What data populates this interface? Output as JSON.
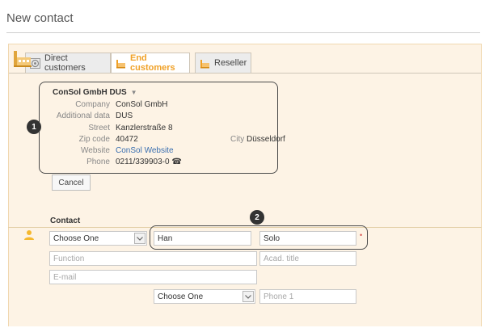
{
  "page": {
    "title": "New contact"
  },
  "tabs": [
    {
      "label": "Direct customers",
      "icon": "target-icon",
      "active": false
    },
    {
      "label": "End customers",
      "icon": "building-icon",
      "active": true
    },
    {
      "label": "Reseller",
      "icon": "building-icon",
      "active": false
    }
  ],
  "company": {
    "name": "ConSol GmbH DUS",
    "rows": {
      "company": {
        "label": "Company",
        "value": "ConSol GmbH"
      },
      "additional": {
        "label": "Additional data",
        "value": "DUS"
      },
      "street": {
        "label": "Street",
        "value": "Kanzlerstraße 8"
      },
      "zip": {
        "label": "Zip code",
        "value": "40472"
      },
      "city": {
        "label": "City",
        "value": "Düsseldorf"
      },
      "website": {
        "label": "Website",
        "value": "ConSol Website"
      },
      "phone": {
        "label": "Phone",
        "value": "0211/339903-0",
        "icon": "telephone-icon"
      }
    },
    "cancel_label": "Cancel"
  },
  "callouts": {
    "one": "1",
    "two": "2"
  },
  "contact": {
    "section_label": "Contact",
    "salutation_select": "Choose One",
    "first_name": "Han",
    "last_name": "Solo",
    "function_placeholder": "Function",
    "acad_title_placeholder": "Acad. title",
    "email_placeholder": "E-mail",
    "phone_type_select": "Choose One",
    "phone_placeholder": "Phone 1"
  },
  "colors": {
    "accent": "#f0a127",
    "panel": "#fdf3e5",
    "link": "#3a6fb0",
    "required": "#d9534f"
  }
}
